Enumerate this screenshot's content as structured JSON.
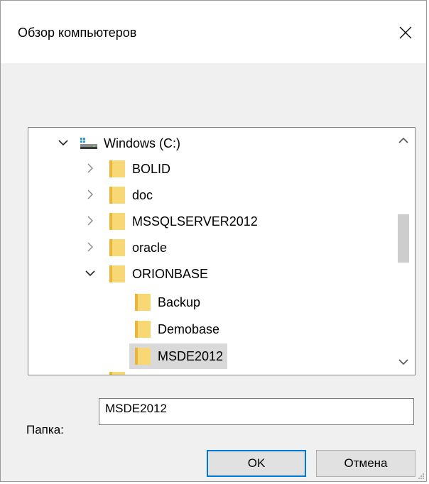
{
  "dialog": {
    "title": "Обзор компьютеров",
    "close_icon": "close-icon"
  },
  "tree": {
    "items": [
      {
        "label": "Windows (C:)",
        "icon": "drive-icon",
        "chevron": "expanded",
        "level": 0
      },
      {
        "label": "BOLID",
        "icon": "folder-icon",
        "chevron": "collapsed",
        "level": 1
      },
      {
        "label": "doc",
        "icon": "folder-icon",
        "chevron": "collapsed",
        "level": 1
      },
      {
        "label": "MSSQLSERVER2012",
        "icon": "folder-icon",
        "chevron": "collapsed",
        "level": 1
      },
      {
        "label": "oracle",
        "icon": "folder-icon",
        "chevron": "collapsed",
        "level": 1
      },
      {
        "label": "ORIONBASE",
        "icon": "folder-icon",
        "chevron": "expanded",
        "level": 1
      },
      {
        "label": "Backup",
        "icon": "folder-icon",
        "chevron": "none",
        "level": 2
      },
      {
        "label": "Demobase",
        "icon": "folder-icon",
        "chevron": "none",
        "level": 2
      },
      {
        "label": "MSDE2012",
        "icon": "folder-icon",
        "chevron": "none",
        "level": 2,
        "selected": true
      }
    ]
  },
  "folder": {
    "label": "Папка:",
    "value": "MSDE2012"
  },
  "buttons": {
    "ok": "OK",
    "cancel": "Отмена"
  },
  "colors": {
    "folder": "#f8d775",
    "folder_dark": "#e8b73a",
    "accent": "#0078d7",
    "drive": "#2d9bd8"
  }
}
